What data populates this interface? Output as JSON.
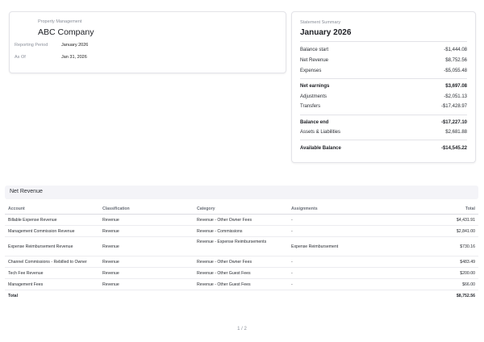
{
  "header": {
    "kicker": "Property Management",
    "company": "ABC Company",
    "reporting_period_label": "Reporting Period",
    "reporting_period_value": "January 2026",
    "as_of_label": "As Of",
    "as_of_value": "Jan 31, 2026"
  },
  "summary": {
    "kicker": "Statement Summary",
    "title": "January 2026",
    "rows": [
      {
        "label": "Balance start",
        "value": "-$1,444.08"
      },
      {
        "label": "Net Revenue",
        "value": "$8,752.56"
      },
      {
        "label": "Expenses",
        "value": "-$5,055.48"
      },
      {
        "label": "Net earnings",
        "value": "$3,697.08"
      },
      {
        "label": "Adjustments",
        "value": "-$2,051.13"
      },
      {
        "label": "Transfers",
        "value": "-$17,428.97"
      },
      {
        "label": "Balance end",
        "value": "-$17,227.10"
      },
      {
        "label": "Assets & Liabilities",
        "value": "$2,681.88"
      },
      {
        "label": "Available Balance",
        "value": "-$14,545.22"
      }
    ]
  },
  "net_revenue": {
    "section_title": "Net Revenue",
    "columns": [
      "Account",
      "Classification",
      "Category",
      "Assignments",
      "Total"
    ],
    "rows": [
      [
        "Billable Expense Revenue",
        "Revenue",
        "Revenue - Other Owner Fees",
        "-",
        "$4,431.91"
      ],
      [
        "Management Commission Revenue",
        "Revenue",
        "Revenue - Commissions",
        "-",
        "$2,841.00"
      ],
      [
        "Expense Reimbursement Revenue",
        "Revenue",
        "Revenue - Expense Reimbursements",
        "Expense Reimbursement",
        "$730.16"
      ],
      [
        "Channel Commissions - Rebilled to Owner",
        "Revenue",
        "Revenue - Other Owner Fees",
        "-",
        "$483.49"
      ],
      [
        "Tech Fee Revenue",
        "Revenue",
        "Revenue - Other Guest Fees",
        "-",
        "$200.00"
      ],
      [
        "Management Fees",
        "Revenue",
        "Revenue - Other Guest Fees",
        "-",
        "$66.00"
      ]
    ],
    "total_label": "Total",
    "total_value": "$8,752.56"
  },
  "pager": "1 / 2"
}
